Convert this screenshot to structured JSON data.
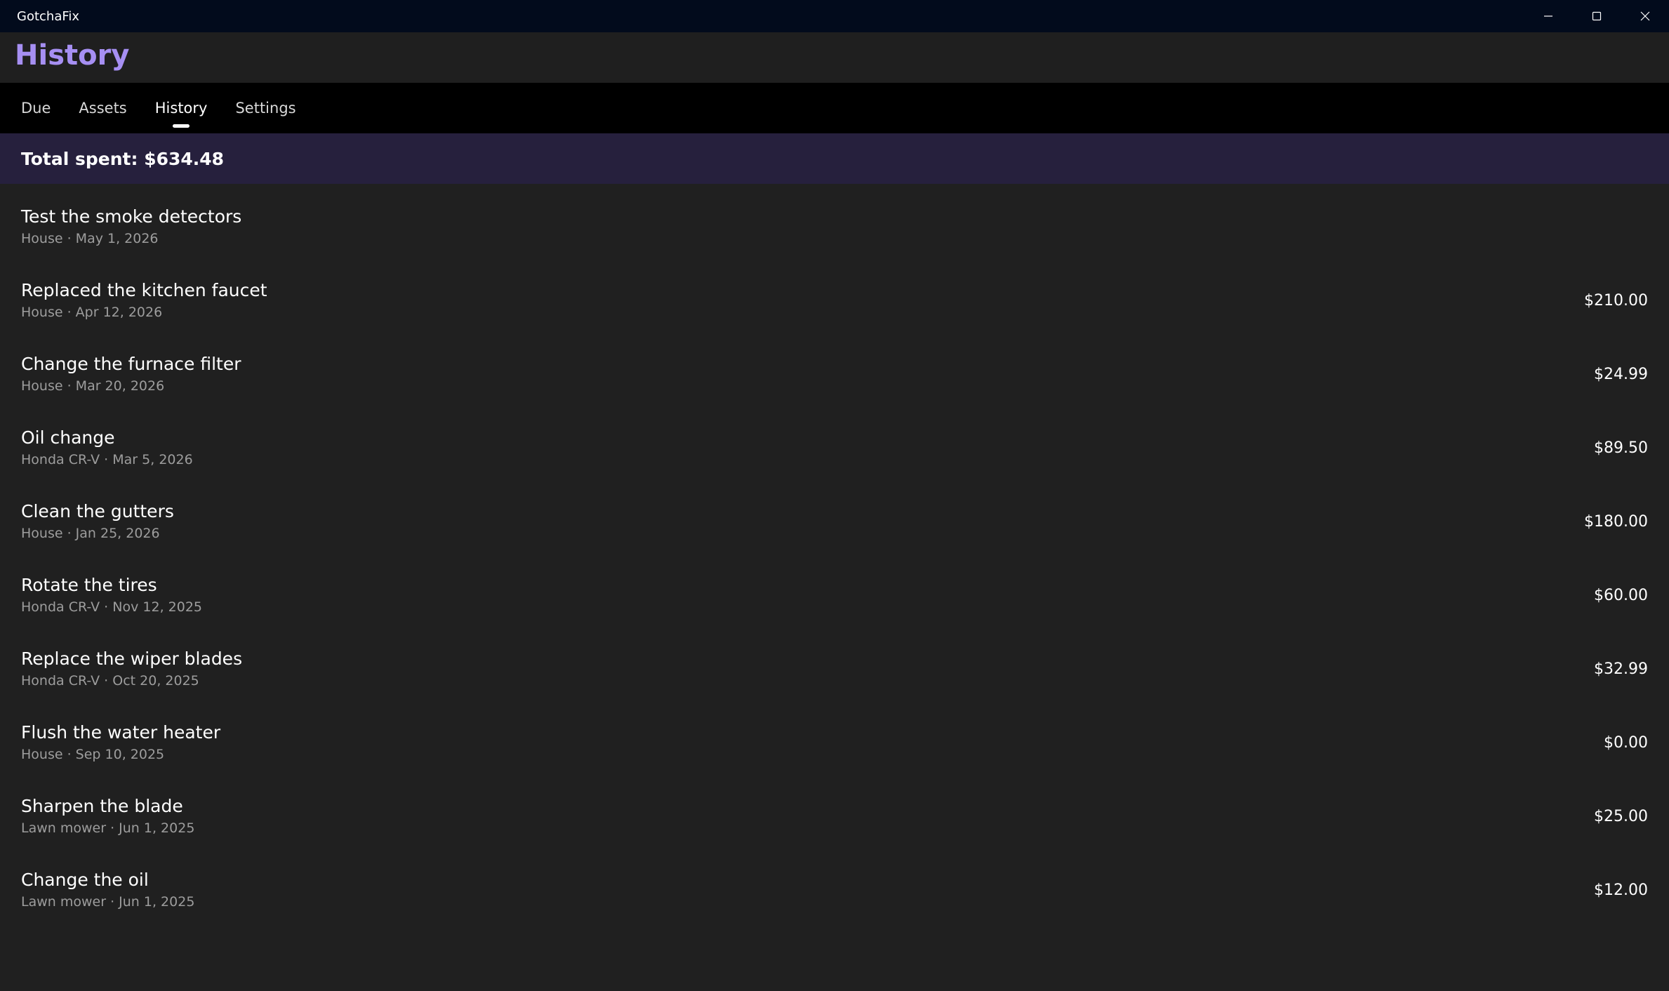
{
  "window": {
    "title": "GotchaFix",
    "controls": {
      "minimize": "minimize-icon",
      "maximize": "maximize-icon",
      "close": "close-icon"
    }
  },
  "header": {
    "title": "History"
  },
  "tabs": [
    {
      "label": "Due",
      "active": false
    },
    {
      "label": "Assets",
      "active": false
    },
    {
      "label": "History",
      "active": true
    },
    {
      "label": "Settings",
      "active": false
    }
  ],
  "summary": {
    "label": "Total spent:",
    "value": "$634.48"
  },
  "history": [
    {
      "title": "Test the smoke detectors",
      "asset": "House",
      "date": "May 1, 2026",
      "cost": ""
    },
    {
      "title": "Replaced the kitchen faucet",
      "asset": "House",
      "date": "Apr 12, 2026",
      "cost": "$210.00"
    },
    {
      "title": "Change the furnace filter",
      "asset": "House",
      "date": "Mar 20, 2026",
      "cost": "$24.99"
    },
    {
      "title": "Oil change",
      "asset": "Honda CR-V",
      "date": "Mar 5, 2026",
      "cost": "$89.50"
    },
    {
      "title": "Clean the gutters",
      "asset": "House",
      "date": "Jan 25, 2026",
      "cost": "$180.00"
    },
    {
      "title": "Rotate the tires",
      "asset": "Honda CR-V",
      "date": "Nov 12, 2025",
      "cost": "$60.00"
    },
    {
      "title": "Replace the wiper blades",
      "asset": "Honda CR-V",
      "date": "Oct 20, 2025",
      "cost": "$32.99"
    },
    {
      "title": "Flush the water heater",
      "asset": "House",
      "date": "Sep 10, 2025",
      "cost": "$0.00"
    },
    {
      "title": "Sharpen the blade",
      "asset": "Lawn mower",
      "date": "Jun 1, 2025",
      "cost": "$25.00"
    },
    {
      "title": "Change the oil",
      "asset": "Lawn mower",
      "date": "Jun 1, 2025",
      "cost": "$12.00"
    }
  ],
  "colors": {
    "accent": "#a68ff2",
    "titlebar": "#020b1c",
    "tabbar": "#000000",
    "summary_bg": "#26203d",
    "background": "#202020",
    "subtext": "#9d9d9d"
  }
}
